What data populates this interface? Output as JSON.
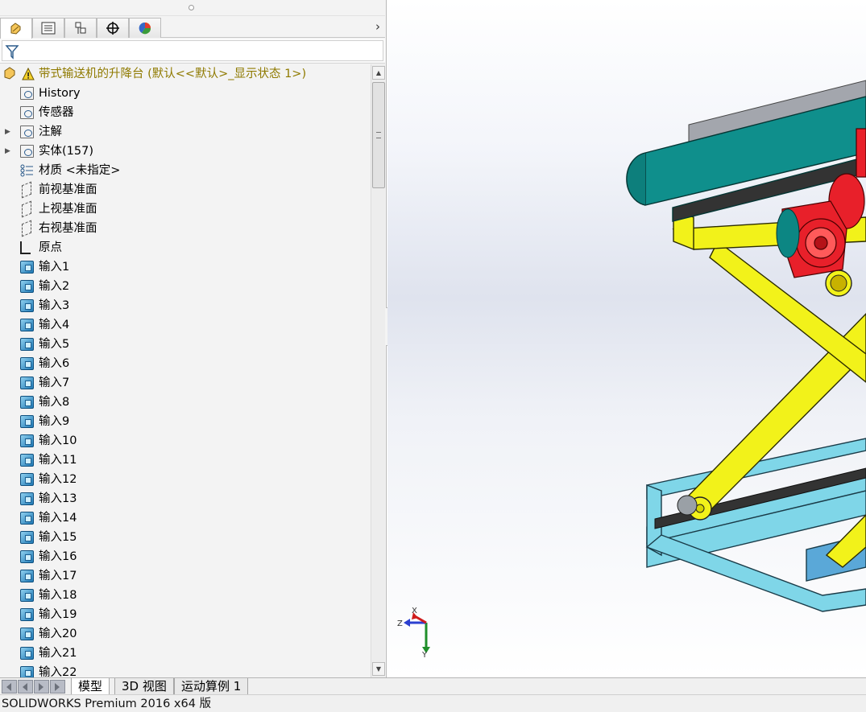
{
  "root": {
    "label": "带式输送机的升降台  (默认<<默认>_显示状态 1>)",
    "label_color": "#8f7a00"
  },
  "tree": [
    {
      "label": "History",
      "icon": "history-folder-icon",
      "expandable": false,
      "kind": "folder"
    },
    {
      "label": "传感器",
      "icon": "sensors-folder-icon",
      "expandable": false,
      "kind": "folder"
    },
    {
      "label": "注解",
      "icon": "annotations-folder-icon",
      "expandable": true,
      "kind": "folder"
    },
    {
      "label": "实体(157)",
      "icon": "solid-bodies-folder-icon",
      "expandable": true,
      "kind": "folder"
    },
    {
      "label": "材质 <未指定>",
      "icon": "material-icon",
      "expandable": false,
      "kind": "material"
    },
    {
      "label": "前视基准面",
      "icon": "plane-icon",
      "expandable": false,
      "kind": "plane"
    },
    {
      "label": "上视基准面",
      "icon": "plane-icon",
      "expandable": false,
      "kind": "plane"
    },
    {
      "label": "右视基准面",
      "icon": "plane-icon",
      "expandable": false,
      "kind": "plane"
    },
    {
      "label": "原点",
      "icon": "origin-icon",
      "expandable": false,
      "kind": "origin"
    },
    {
      "label": "输入1",
      "icon": "imported-body-icon",
      "expandable": false,
      "kind": "solid"
    },
    {
      "label": "输入2",
      "icon": "imported-body-icon",
      "expandable": false,
      "kind": "solid"
    },
    {
      "label": "输入3",
      "icon": "imported-body-icon",
      "expandable": false,
      "kind": "solid"
    },
    {
      "label": "输入4",
      "icon": "imported-body-icon",
      "expandable": false,
      "kind": "solid"
    },
    {
      "label": "输入5",
      "icon": "imported-body-icon",
      "expandable": false,
      "kind": "solid"
    },
    {
      "label": "输入6",
      "icon": "imported-body-icon",
      "expandable": false,
      "kind": "solid"
    },
    {
      "label": "输入7",
      "icon": "imported-body-icon",
      "expandable": false,
      "kind": "solid"
    },
    {
      "label": "输入8",
      "icon": "imported-body-icon",
      "expandable": false,
      "kind": "solid"
    },
    {
      "label": "输入9",
      "icon": "imported-body-icon",
      "expandable": false,
      "kind": "solid"
    },
    {
      "label": "输入10",
      "icon": "imported-body-icon",
      "expandable": false,
      "kind": "solid"
    },
    {
      "label": "输入11",
      "icon": "imported-body-icon",
      "expandable": false,
      "kind": "solid"
    },
    {
      "label": "输入12",
      "icon": "imported-body-icon",
      "expandable": false,
      "kind": "solid"
    },
    {
      "label": "输入13",
      "icon": "imported-body-icon",
      "expandable": false,
      "kind": "solid"
    },
    {
      "label": "输入14",
      "icon": "imported-body-icon",
      "expandable": false,
      "kind": "solid"
    },
    {
      "label": "输入15",
      "icon": "imported-body-icon",
      "expandable": false,
      "kind": "solid"
    },
    {
      "label": "输入16",
      "icon": "imported-body-icon",
      "expandable": false,
      "kind": "solid"
    },
    {
      "label": "输入17",
      "icon": "imported-body-icon",
      "expandable": false,
      "kind": "solid"
    },
    {
      "label": "输入18",
      "icon": "imported-body-icon",
      "expandable": false,
      "kind": "solid"
    },
    {
      "label": "输入19",
      "icon": "imported-body-icon",
      "expandable": false,
      "kind": "solid"
    },
    {
      "label": "输入20",
      "icon": "imported-body-icon",
      "expandable": false,
      "kind": "solid"
    },
    {
      "label": "输入21",
      "icon": "imported-body-icon",
      "expandable": false,
      "kind": "solid"
    },
    {
      "label": "输入22",
      "icon": "imported-body-icon",
      "expandable": false,
      "kind": "solid"
    }
  ],
  "manager_tabs": [
    {
      "icon": "feature-manager-icon",
      "active": true
    },
    {
      "icon": "property-manager-icon",
      "active": false
    },
    {
      "icon": "configuration-manager-icon",
      "active": false
    },
    {
      "icon": "dimxpert-manager-icon",
      "active": false
    },
    {
      "icon": "display-manager-icon",
      "active": false
    }
  ],
  "bottom_tabs": [
    {
      "label": "模型",
      "active": true
    },
    {
      "label": "3D 视图",
      "active": false
    },
    {
      "label": "运动算例 1",
      "active": false
    }
  ],
  "triad": {
    "x": "X",
    "y": "Y",
    "z": "Z"
  },
  "status": {
    "text": "SOLIDWORKS Premium 2016 x64 版"
  },
  "colors": {
    "belt": "#0f8f8c",
    "motor": "#e8202a",
    "scissor": "#f2f21a",
    "base_frame": "#7fd6e8",
    "panel_bg": "#f3f3f3"
  }
}
